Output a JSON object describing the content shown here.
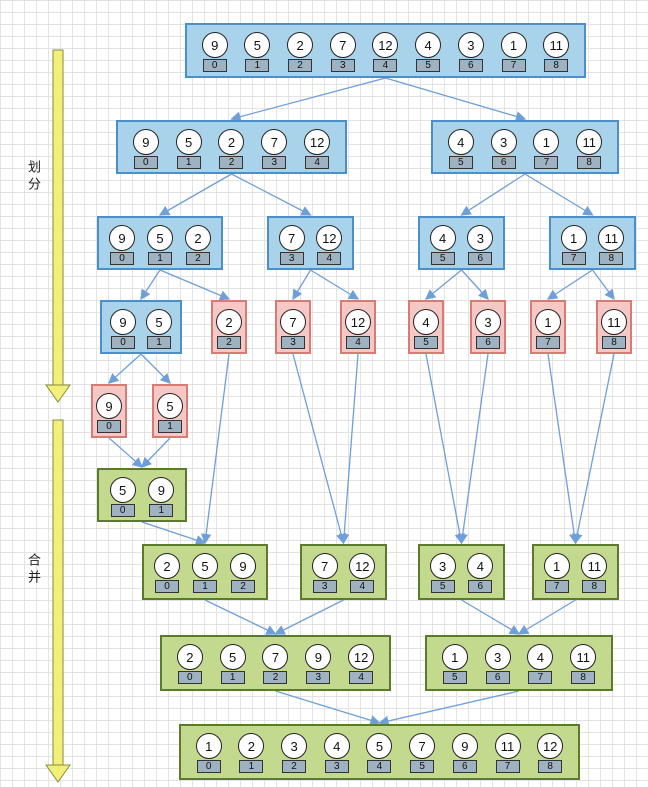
{
  "labels": {
    "split": "划分",
    "merge": "合并"
  },
  "colors": {
    "split_box": "#a9d3ea",
    "leaf_box": "#f5c8c5",
    "merge_box": "#c3d98d",
    "arrow": "#6f9fd8",
    "timeline_arrow": "#f3f07a"
  },
  "boxes": [
    {
      "id": "s0",
      "kind": "blue",
      "values": [
        9,
        5,
        2,
        7,
        12,
        4,
        3,
        1,
        11
      ],
      "indices": [
        0,
        1,
        2,
        3,
        4,
        5,
        6,
        7,
        8
      ]
    },
    {
      "id": "s1a",
      "kind": "blue",
      "values": [
        9,
        5,
        2,
        7,
        12
      ],
      "indices": [
        0,
        1,
        2,
        3,
        4
      ]
    },
    {
      "id": "s1b",
      "kind": "blue",
      "values": [
        4,
        3,
        1,
        11
      ],
      "indices": [
        5,
        6,
        7,
        8
      ]
    },
    {
      "id": "s2a",
      "kind": "blue",
      "values": [
        9,
        5,
        2
      ],
      "indices": [
        0,
        1,
        2
      ]
    },
    {
      "id": "s2b",
      "kind": "blue",
      "values": [
        7,
        12
      ],
      "indices": [
        3,
        4
      ]
    },
    {
      "id": "s2c",
      "kind": "blue",
      "values": [
        4,
        3
      ],
      "indices": [
        5,
        6
      ]
    },
    {
      "id": "s2d",
      "kind": "blue",
      "values": [
        1,
        11
      ],
      "indices": [
        7,
        8
      ]
    },
    {
      "id": "s3a",
      "kind": "blue",
      "values": [
        9,
        5
      ],
      "indices": [
        0,
        1
      ]
    },
    {
      "id": "l2",
      "kind": "red",
      "values": [
        2
      ],
      "indices": [
        2
      ]
    },
    {
      "id": "l7",
      "kind": "red",
      "values": [
        7
      ],
      "indices": [
        3
      ]
    },
    {
      "id": "l12",
      "kind": "red",
      "values": [
        12
      ],
      "indices": [
        4
      ]
    },
    {
      "id": "l4",
      "kind": "red",
      "values": [
        4
      ],
      "indices": [
        5
      ]
    },
    {
      "id": "l3",
      "kind": "red",
      "values": [
        3
      ],
      "indices": [
        6
      ]
    },
    {
      "id": "l1",
      "kind": "red",
      "values": [
        1
      ],
      "indices": [
        7
      ]
    },
    {
      "id": "l11",
      "kind": "red",
      "values": [
        11
      ],
      "indices": [
        8
      ]
    },
    {
      "id": "l9",
      "kind": "red",
      "values": [
        9
      ],
      "indices": [
        0
      ]
    },
    {
      "id": "l5",
      "kind": "red",
      "values": [
        5
      ],
      "indices": [
        1
      ]
    },
    {
      "id": "m1",
      "kind": "green",
      "values": [
        5,
        9
      ],
      "indices": [
        0,
        1
      ]
    },
    {
      "id": "m2a",
      "kind": "green",
      "values": [
        2,
        5,
        9
      ],
      "indices": [
        0,
        1,
        2
      ]
    },
    {
      "id": "m2b",
      "kind": "green",
      "values": [
        7,
        12
      ],
      "indices": [
        3,
        4
      ]
    },
    {
      "id": "m2c",
      "kind": "green",
      "values": [
        3,
        4
      ],
      "indices": [
        5,
        6
      ]
    },
    {
      "id": "m2d",
      "kind": "green",
      "values": [
        1,
        11
      ],
      "indices": [
        7,
        8
      ]
    },
    {
      "id": "m3a",
      "kind": "green",
      "values": [
        2,
        5,
        7,
        9,
        12
      ],
      "indices": [
        0,
        1,
        2,
        3,
        4
      ]
    },
    {
      "id": "m3b",
      "kind": "green",
      "values": [
        1,
        3,
        4,
        11
      ],
      "indices": [
        5,
        6,
        7,
        8
      ]
    },
    {
      "id": "m4",
      "kind": "green",
      "values": [
        1,
        2,
        3,
        4,
        5,
        7,
        9,
        11,
        12
      ],
      "indices": [
        0,
        1,
        2,
        3,
        4,
        5,
        6,
        7,
        8
      ]
    }
  ],
  "edges": [
    [
      "s0",
      "s1a"
    ],
    [
      "s0",
      "s1b"
    ],
    [
      "s1a",
      "s2a"
    ],
    [
      "s1a",
      "s2b"
    ],
    [
      "s1b",
      "s2c"
    ],
    [
      "s1b",
      "s2d"
    ],
    [
      "s2a",
      "s3a"
    ],
    [
      "s2a",
      "l2"
    ],
    [
      "s2b",
      "l7"
    ],
    [
      "s2b",
      "l12"
    ],
    [
      "s2c",
      "l4"
    ],
    [
      "s2c",
      "l3"
    ],
    [
      "s2d",
      "l1"
    ],
    [
      "s2d",
      "l11"
    ],
    [
      "s3a",
      "l9"
    ],
    [
      "s3a",
      "l5"
    ],
    [
      "l9",
      "m1"
    ],
    [
      "l5",
      "m1"
    ],
    [
      "m1",
      "m2a"
    ],
    [
      "l2",
      "m2a"
    ],
    [
      "l7",
      "m2b"
    ],
    [
      "l12",
      "m2b"
    ],
    [
      "l4",
      "m2c"
    ],
    [
      "l3",
      "m2c"
    ],
    [
      "l1",
      "m2d"
    ],
    [
      "l11",
      "m2d"
    ],
    [
      "m2a",
      "m3a"
    ],
    [
      "m2b",
      "m3a"
    ],
    [
      "m2c",
      "m3b"
    ],
    [
      "m2d",
      "m3b"
    ],
    [
      "m3a",
      "m4"
    ],
    [
      "m3b",
      "m4"
    ]
  ]
}
